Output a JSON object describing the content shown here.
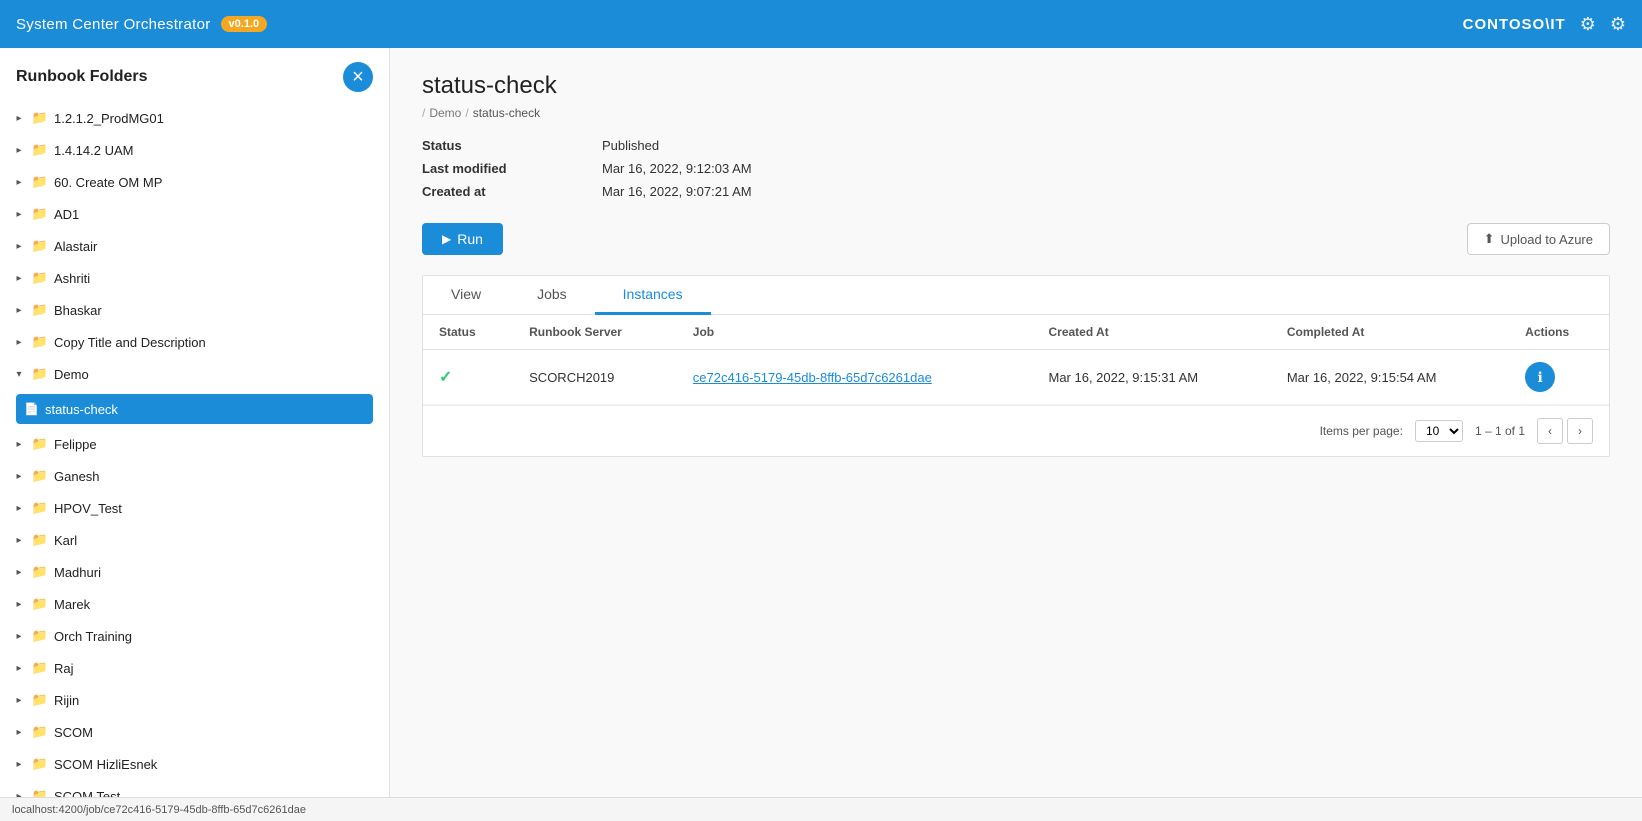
{
  "topnav": {
    "title": "System Center Orchestrator",
    "version": "v0.1.0",
    "org": "CONTOSO\\IT",
    "settings_icon": "⚙",
    "gear_icon": "⚙"
  },
  "sidebar": {
    "title": "Runbook Folders",
    "add_btn_label": "×",
    "items": [
      {
        "id": "1212",
        "label": "1.2.1.2_ProdMG01",
        "expanded": false
      },
      {
        "id": "1414",
        "label": "1.4.14.2 UAM",
        "expanded": false
      },
      {
        "id": "60create",
        "label": "60. Create OM MP",
        "expanded": false
      },
      {
        "id": "ad1",
        "label": "AD1",
        "expanded": false
      },
      {
        "id": "alastair",
        "label": "Alastair",
        "expanded": false
      },
      {
        "id": "ashriti",
        "label": "Ashriti",
        "expanded": false
      },
      {
        "id": "bhaskar",
        "label": "Bhaskar",
        "expanded": false
      },
      {
        "id": "copytitle",
        "label": "Copy Title and Description",
        "expanded": false
      },
      {
        "id": "demo",
        "label": "Demo",
        "expanded": true
      },
      {
        "id": "felippe",
        "label": "Felippe",
        "expanded": false
      },
      {
        "id": "ganesh",
        "label": "Ganesh",
        "expanded": false
      },
      {
        "id": "hpov",
        "label": "HPOV_Test",
        "expanded": false
      },
      {
        "id": "karl",
        "label": "Karl",
        "expanded": false
      },
      {
        "id": "madhuri",
        "label": "Madhuri",
        "expanded": false
      },
      {
        "id": "marek",
        "label": "Marek",
        "expanded": false
      },
      {
        "id": "orchtraining",
        "label": "Orch Training",
        "expanded": false
      },
      {
        "id": "raj",
        "label": "Raj",
        "expanded": false
      },
      {
        "id": "rijin",
        "label": "Rijin",
        "expanded": false
      },
      {
        "id": "scom",
        "label": "SCOM",
        "expanded": false
      },
      {
        "id": "scomhizli",
        "label": "SCOM HizliEsnek",
        "expanded": false
      },
      {
        "id": "scomtest",
        "label": "SCOM Test",
        "expanded": false
      }
    ],
    "demo_child": "status-check",
    "selected_runbook": "status-check"
  },
  "main": {
    "page_title": "status-check",
    "breadcrumb": [
      {
        "label": "Demo",
        "link": true
      },
      {
        "label": "status-check",
        "link": false
      }
    ],
    "status_label": "Status",
    "status_value": "Published",
    "last_modified_label": "Last modified",
    "last_modified_value": "Mar 16, 2022, 9:12:03 AM",
    "created_at_label": "Created at",
    "created_at_value": "Mar 16, 2022, 9:07:21 AM",
    "run_btn_label": "Run",
    "upload_btn_label": "Upload to Azure",
    "upload_icon": "⬆",
    "tabs": [
      {
        "id": "view",
        "label": "View",
        "active": false
      },
      {
        "id": "jobs",
        "label": "Jobs",
        "active": false
      },
      {
        "id": "instances",
        "label": "Instances",
        "active": true
      }
    ],
    "table": {
      "columns": [
        "Status",
        "Runbook Server",
        "Job",
        "Created At",
        "Completed At",
        "Actions"
      ],
      "rows": [
        {
          "status": "✓",
          "runbook_server": "SCORCH2019",
          "job": "ce72c416-5179-45db-8ffb-65d7c6261dae",
          "created_at": "Mar 16, 2022, 9:15:31 AM",
          "completed_at": "Mar 16, 2022, 9:15:54 AM"
        }
      ]
    },
    "pagination": {
      "items_per_page_label": "Items per page:",
      "items_per_page_value": "10",
      "range": "1 – 1 of 1"
    }
  },
  "statusbar": {
    "url": "localhost:4200/job/ce72c416-5179-45db-8ffb-65d7c6261dae"
  }
}
